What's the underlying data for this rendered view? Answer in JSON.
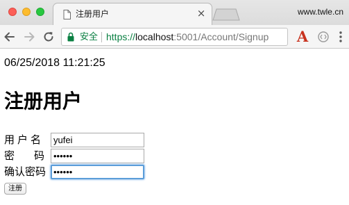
{
  "tab": {
    "title": "注册用户",
    "close_glyph": "×"
  },
  "profile_label": "www.twle.cn",
  "addressbar": {
    "secure_label": "安全",
    "url_scheme": "https://",
    "url_host": "localhost",
    "url_path": ":5001/Account/Signup"
  },
  "extensions": {
    "a_glyph": "A"
  },
  "icons": {
    "back": "arrow-left",
    "forward": "arrow-right",
    "reload": "reload",
    "lock": "lock",
    "page": "document",
    "menu": "three-dots-vertical"
  },
  "colors": {
    "secure_green": "#0b8043",
    "focus_blue": "#5b9dd9",
    "extension_red": "#c8321e"
  },
  "page": {
    "timestamp": "06/25/2018 11:21:25",
    "heading": "注册用户"
  },
  "form": {
    "username_label": "用户名",
    "username_value": "yufei",
    "password_label": "密码",
    "password_value": "••••••",
    "confirm_label": "确认密码",
    "confirm_value": "••••••",
    "submit_label": "注册"
  }
}
